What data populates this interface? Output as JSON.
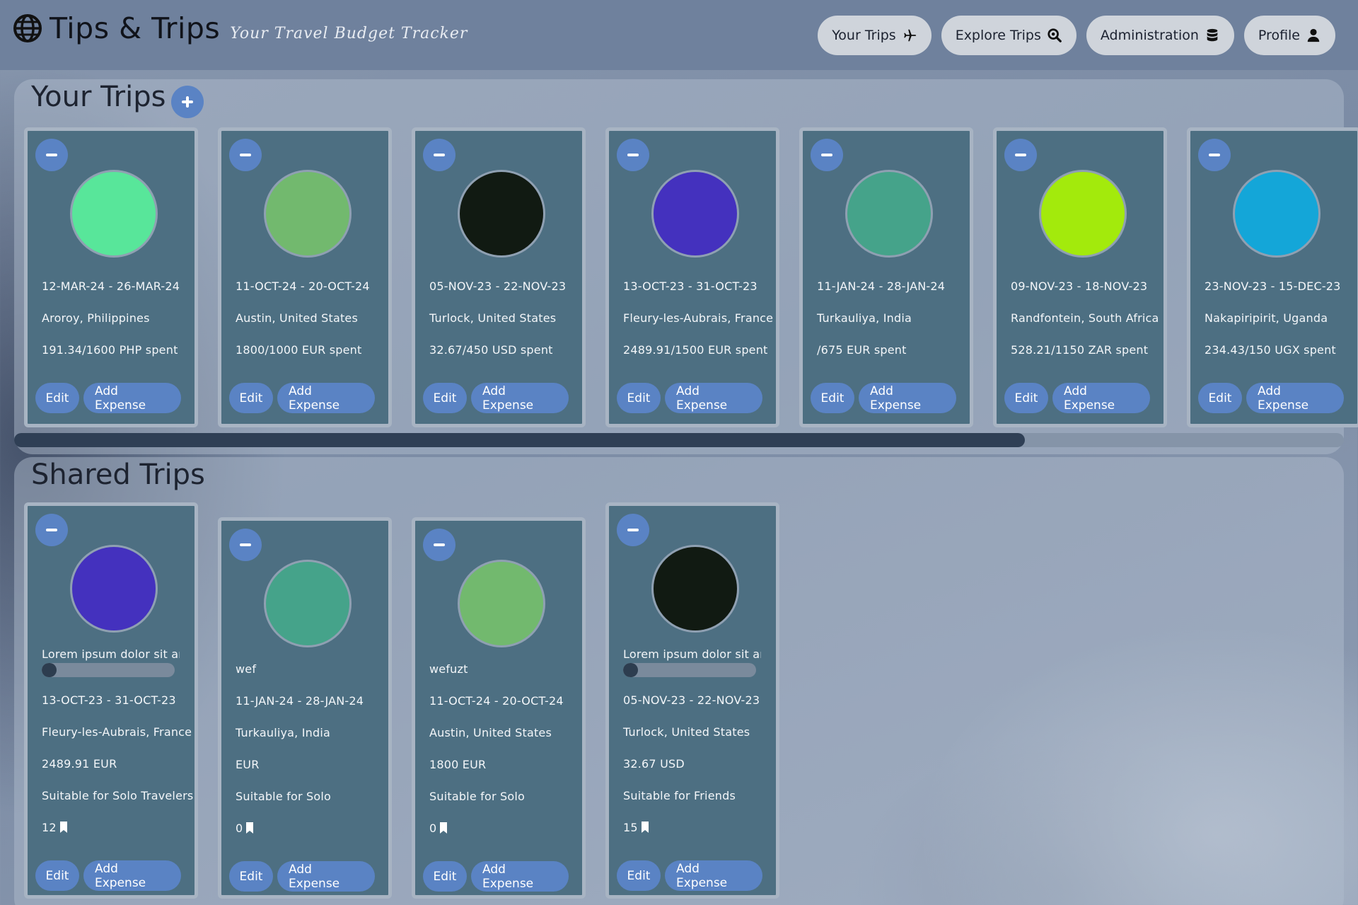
{
  "header": {
    "title": "Tips & Trips",
    "tagline": "Your Travel Budget Tracker",
    "logo_icon": "globe-icon",
    "nav": [
      {
        "label": "Your Trips",
        "icon": "plane-icon"
      },
      {
        "label": "Explore Trips",
        "icon": "search-icon"
      },
      {
        "label": "Administration",
        "icon": "database-icon"
      },
      {
        "label": "Profile",
        "icon": "user-icon"
      }
    ]
  },
  "your_trips": {
    "title": "Your Trips",
    "add_icon": "plus-icon",
    "scroll_fraction": 0.76,
    "trips": [
      {
        "color": "#58e69a",
        "dates": "12-MAR-24 - 26-MAR-24",
        "location": "Aroroy, Philippines",
        "spent": "191.34/1600 PHP spent",
        "edit": "Edit",
        "add": "Add Expense"
      },
      {
        "color": "#72b96e",
        "dates": "11-OCT-24 - 20-OCT-24",
        "location": "Austin, United States",
        "spent": "1800/1000 EUR spent",
        "edit": "Edit",
        "add": "Add Expense"
      },
      {
        "color": "#111a12",
        "dates": "05-NOV-23 - 22-NOV-23",
        "location": "Turlock, United States",
        "spent": "32.67/450 USD spent",
        "edit": "Edit",
        "add": "Add Expense"
      },
      {
        "color": "#4431be",
        "dates": "13-OCT-23 - 31-OCT-23",
        "location": "Fleury-les-Aubrais, France",
        "spent": "2489.91/1500 EUR spent",
        "edit": "Edit",
        "add": "Add Expense"
      },
      {
        "color": "#45a38a",
        "dates": "11-JAN-24 - 28-JAN-24",
        "location": "Turkauliya, India",
        "spent": "/675 EUR spent",
        "edit": "Edit",
        "add": "Add Expense"
      },
      {
        "color": "#a3ea0c",
        "dates": "09-NOV-23 - 18-NOV-23",
        "location": "Randfontein, South Africa",
        "spent": "528.21/1150 ZAR spent",
        "edit": "Edit",
        "add": "Add Expense"
      },
      {
        "color": "#14a6d8",
        "dates": "23-NOV-23 - 15-DEC-23",
        "location": "Nakapiripirit, Uganda",
        "spent": "234.43/150 UGX spent",
        "edit": "Edit",
        "add": "Add Expense"
      }
    ]
  },
  "shared_trips": {
    "title": "Shared Trips",
    "trips": [
      {
        "color": "#4431be",
        "description": "Lorem ipsum dolor sit amet",
        "progress": 0.08,
        "dates": "13-OCT-23 - 31-OCT-23",
        "location": "Fleury-les-Aubrais, France",
        "amount": "2489.91 EUR",
        "suitable": "Suitable for Solo Travelers",
        "bookmarks": "12",
        "edit": "Edit",
        "add": "Add Expense"
      },
      {
        "color": "#45a38a",
        "description": "wef",
        "dates": "11-JAN-24 - 28-JAN-24",
        "location": "Turkauliya, India",
        "amount": "EUR",
        "suitable": "Suitable for Solo",
        "bookmarks": "0",
        "edit": "Edit",
        "add": "Add Expense"
      },
      {
        "color": "#72b96e",
        "description": "wefuzt",
        "dates": "11-OCT-24 - 20-OCT-24",
        "location": "Austin, United States",
        "amount": "1800 EUR",
        "suitable": "Suitable for Solo",
        "bookmarks": "0",
        "edit": "Edit",
        "add": "Add Expense"
      },
      {
        "color": "#111a12",
        "description": "Lorem ipsum dolor sit amet",
        "progress": 0.08,
        "dates": "05-NOV-23 - 22-NOV-23",
        "location": "Turlock, United States",
        "amount": "32.67 USD",
        "suitable": "Suitable for Friends",
        "bookmarks": "15",
        "edit": "Edit",
        "add": "Add Expense"
      }
    ]
  }
}
